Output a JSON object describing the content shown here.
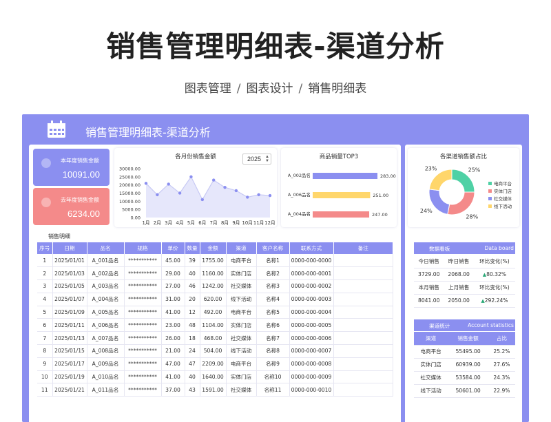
{
  "page_title": "销售管理明细表-渠道分析",
  "breadcrumb": [
    "图表管理",
    "图表设计",
    "销售明细表"
  ],
  "colors": {
    "accent": "#8b8ff0",
    "red": "#f48a8a",
    "green": "#4fd1a5",
    "yellow": "#ffd66b"
  },
  "header": {
    "title": "销售管理明细表-渠道分析",
    "icon": "calendar-icon"
  },
  "kpi": {
    "this_year_label": "本年度销售金额",
    "this_year_value": "10091.00",
    "last_year_label": "去年度销售金额",
    "last_year_value": "6234.00"
  },
  "monthly_chart": {
    "title": "各月份销售金额",
    "year": "2025",
    "chart_data": {
      "type": "area",
      "categories": [
        "1月",
        "2月",
        "3月",
        "4月",
        "5月",
        "6月",
        "7月",
        "8月",
        "9月",
        "10月",
        "11月",
        "12月"
      ],
      "values": [
        21000,
        14000,
        20500,
        15000,
        25000,
        11000,
        23000,
        18500,
        16500,
        12500,
        14000,
        13500
      ],
      "ylim": [
        0,
        30000
      ],
      "yticks": [
        "30000.00",
        "25000.00",
        "20000.00",
        "15000.00",
        "10000.00",
        "5000.00",
        "0.00"
      ]
    }
  },
  "top3_chart": {
    "title": "商品销量TOP3",
    "chart_data": {
      "type": "bar",
      "categories": [
        "A_002品名",
        "A_006品名",
        "A_004品名"
      ],
      "values": [
        283,
        251,
        247
      ],
      "labels": [
        "283.00",
        "251.00",
        "247.00"
      ],
      "colors": [
        "#8b8ff0",
        "#ffd66b",
        "#f48a8a"
      ]
    }
  },
  "pie_chart": {
    "title": "各渠道销售额占比",
    "chart_data": {
      "type": "pie",
      "categories": [
        "电商平台",
        "实体门店",
        "社交媒体",
        "线下活动"
      ],
      "values": [
        25,
        28,
        24,
        23
      ],
      "labels": [
        "25%",
        "28%",
        "24%",
        "23%"
      ],
      "colors": [
        "#4fd1a5",
        "#f48a8a",
        "#8b8ff0",
        "#ffd66b"
      ]
    }
  },
  "detail": {
    "section_label": "销售明细",
    "columns": [
      "序号",
      "日期",
      "品名",
      "规格",
      "单价",
      "数量",
      "金额",
      "渠道",
      "客户名称",
      "联系方式",
      "备注"
    ],
    "rows": [
      [
        "1",
        "2025/01/01",
        "A_001品名",
        "***********",
        "45.00",
        "39",
        "1755.00",
        "电商平台",
        "名称1",
        "0000-000-0000",
        ""
      ],
      [
        "2",
        "2025/01/03",
        "A_002品名",
        "***********",
        "29.00",
        "40",
        "1160.00",
        "实体门店",
        "名称2",
        "0000-000-0001",
        ""
      ],
      [
        "3",
        "2025/01/05",
        "A_003品名",
        "***********",
        "27.00",
        "46",
        "1242.00",
        "社交媒体",
        "名称3",
        "0000-000-0002",
        ""
      ],
      [
        "4",
        "2025/01/07",
        "A_004品名",
        "***********",
        "31.00",
        "20",
        "620.00",
        "线下活动",
        "名称4",
        "0000-000-0003",
        ""
      ],
      [
        "5",
        "2025/01/09",
        "A_005品名",
        "***********",
        "41.00",
        "12",
        "492.00",
        "电商平台",
        "名称5",
        "0000-000-0004",
        ""
      ],
      [
        "6",
        "2025/01/11",
        "A_006品名",
        "***********",
        "23.00",
        "48",
        "1104.00",
        "实体门店",
        "名称6",
        "0000-000-0005",
        ""
      ],
      [
        "7",
        "2025/01/13",
        "A_007品名",
        "***********",
        "26.00",
        "18",
        "468.00",
        "社交媒体",
        "名称7",
        "0000-000-0006",
        ""
      ],
      [
        "8",
        "2025/01/15",
        "A_008品名",
        "***********",
        "21.00",
        "24",
        "504.00",
        "线下活动",
        "名称8",
        "0000-000-0007",
        ""
      ],
      [
        "9",
        "2025/01/17",
        "A_009品名",
        "***********",
        "47.00",
        "47",
        "2209.00",
        "电商平台",
        "名称9",
        "0000-000-0008",
        ""
      ],
      [
        "10",
        "2025/01/19",
        "A_010品名",
        "***********",
        "41.00",
        "40",
        "1640.00",
        "实体门店",
        "名称10",
        "0000-000-0009",
        ""
      ],
      [
        "11",
        "2025/01/21",
        "A_011品名",
        "***********",
        "37.00",
        "43",
        "1591.00",
        "社交媒体",
        "名称11",
        "0000-000-0010",
        ""
      ]
    ]
  },
  "data_board": {
    "title": "数据看板",
    "title_en": "Data board",
    "rows": [
      [
        "今日销售",
        "昨日销售",
        "环比变化(%)"
      ],
      [
        "3729.00",
        "2068.00",
        "80.32%"
      ],
      [
        "本月销售",
        "上月销售",
        "环比变化(%)"
      ],
      [
        "8041.00",
        "2050.00",
        "292.24%"
      ]
    ]
  },
  "channel_stats": {
    "title": "渠道统计",
    "title_en": "Account statistics",
    "columns": [
      "渠道",
      "销售金额",
      "占比"
    ],
    "rows": [
      [
        "电商平台",
        "55495.00",
        "25.2%"
      ],
      [
        "实体门店",
        "60939.00",
        "27.6%"
      ],
      [
        "社交媒体",
        "53584.00",
        "24.3%"
      ],
      [
        "线下活动",
        "50601.00",
        "22.9%"
      ]
    ]
  }
}
